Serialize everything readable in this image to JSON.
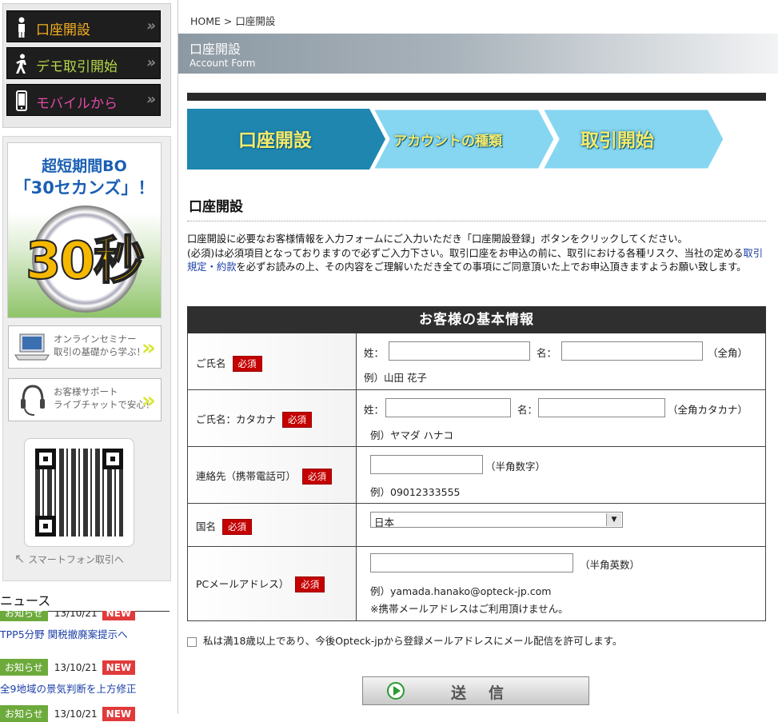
{
  "sidebar": {
    "nav": [
      {
        "label": "口座開設",
        "color": "#f7b020",
        "icon": "person-icon"
      },
      {
        "label": "デモ取引開始",
        "color": "#b6d84a",
        "icon": "walking-icon"
      },
      {
        "label": "モバイルから",
        "color": "#e04aa8",
        "icon": "mobile-phone-icon"
      }
    ],
    "nav_arrow": "»",
    "bo_banner": {
      "line1": "超短期間BO",
      "line2": "「30セカンズ」！",
      "big": "30秒"
    },
    "seminar": {
      "line1": "オンラインセミナー",
      "line2": "取引の基礎から学ぶ！"
    },
    "support": {
      "line1": "お客様サポート",
      "line2": "ライブチャットで安心！"
    },
    "qr_caption": "スマートフォン取引へ",
    "news_title": "ニュース",
    "news": [
      {
        "tag": "お知らせ",
        "date": "13/10/21",
        "badge": "NEW",
        "text": "TPP5分野 関税撤廃案提示へ"
      },
      {
        "tag": "お知らせ",
        "date": "13/10/21",
        "badge": "NEW",
        "text": "全9地域の景気判断を上方修正"
      },
      {
        "tag": "お知らせ",
        "date": "13/10/21",
        "badge": "NEW",
        "text": ""
      }
    ]
  },
  "main": {
    "breadcrumb": "HOME > 口座開設",
    "title_ja": "口座開設",
    "title_en": "Account Form",
    "steps": [
      "口座開設",
      "アカウントの種類",
      "取引開始"
    ],
    "section_title": "口座開設",
    "intro_line1": "口座開設に必要なお客様情報を入力フォームにご入力いただき「口座開設登録」ボタンをクリックしてください。",
    "intro_line2a": "(必須)は必須項目となっておりますので必ずご入力下さい。取引口座をお申込の前に、取引における各種リスク、当社の定める",
    "intro_link": "取引規定・約款",
    "intro_line2b": "を必ずお読みの上、その内容をご理解いただき全ての事項にご同意頂いた上でお申込頂きますようお願い致します。",
    "form_heading": "お客様の基本情報",
    "required_badge": "必須",
    "fields": {
      "name": {
        "label": "ご氏名",
        "sei": "姓：",
        "mei": "名：",
        "note": "（全角）",
        "example": "例）山田 花子"
      },
      "kana": {
        "label": "ご氏名：カタカナ",
        "sei": "姓：",
        "mei": "名：",
        "note": "（全角カタカナ）",
        "example": "例）ヤマダ ハナコ"
      },
      "phone": {
        "label": "連絡先（携帯電話可）",
        "note": "（半角数字）",
        "example": "例）09012333555"
      },
      "country": {
        "label": "国名",
        "selected": "日本"
      },
      "email": {
        "label": "PCメールアドレス）",
        "note": "（半角英数）",
        "example": "例）yamada.hanako@opteck-jp.com",
        "warning": "※携帯メールアドレスはご利用頂けません。"
      }
    },
    "agree_text": "私は満18歳以上であり、今後Opteck-jpから登録メールアドレスにメール配信を許可します。",
    "submit_label": "送信"
  },
  "colors": {
    "step_active": "#1f86b0",
    "step_inactive": "#86d6f1",
    "required": "#c40000",
    "link": "#1a3ea8"
  }
}
